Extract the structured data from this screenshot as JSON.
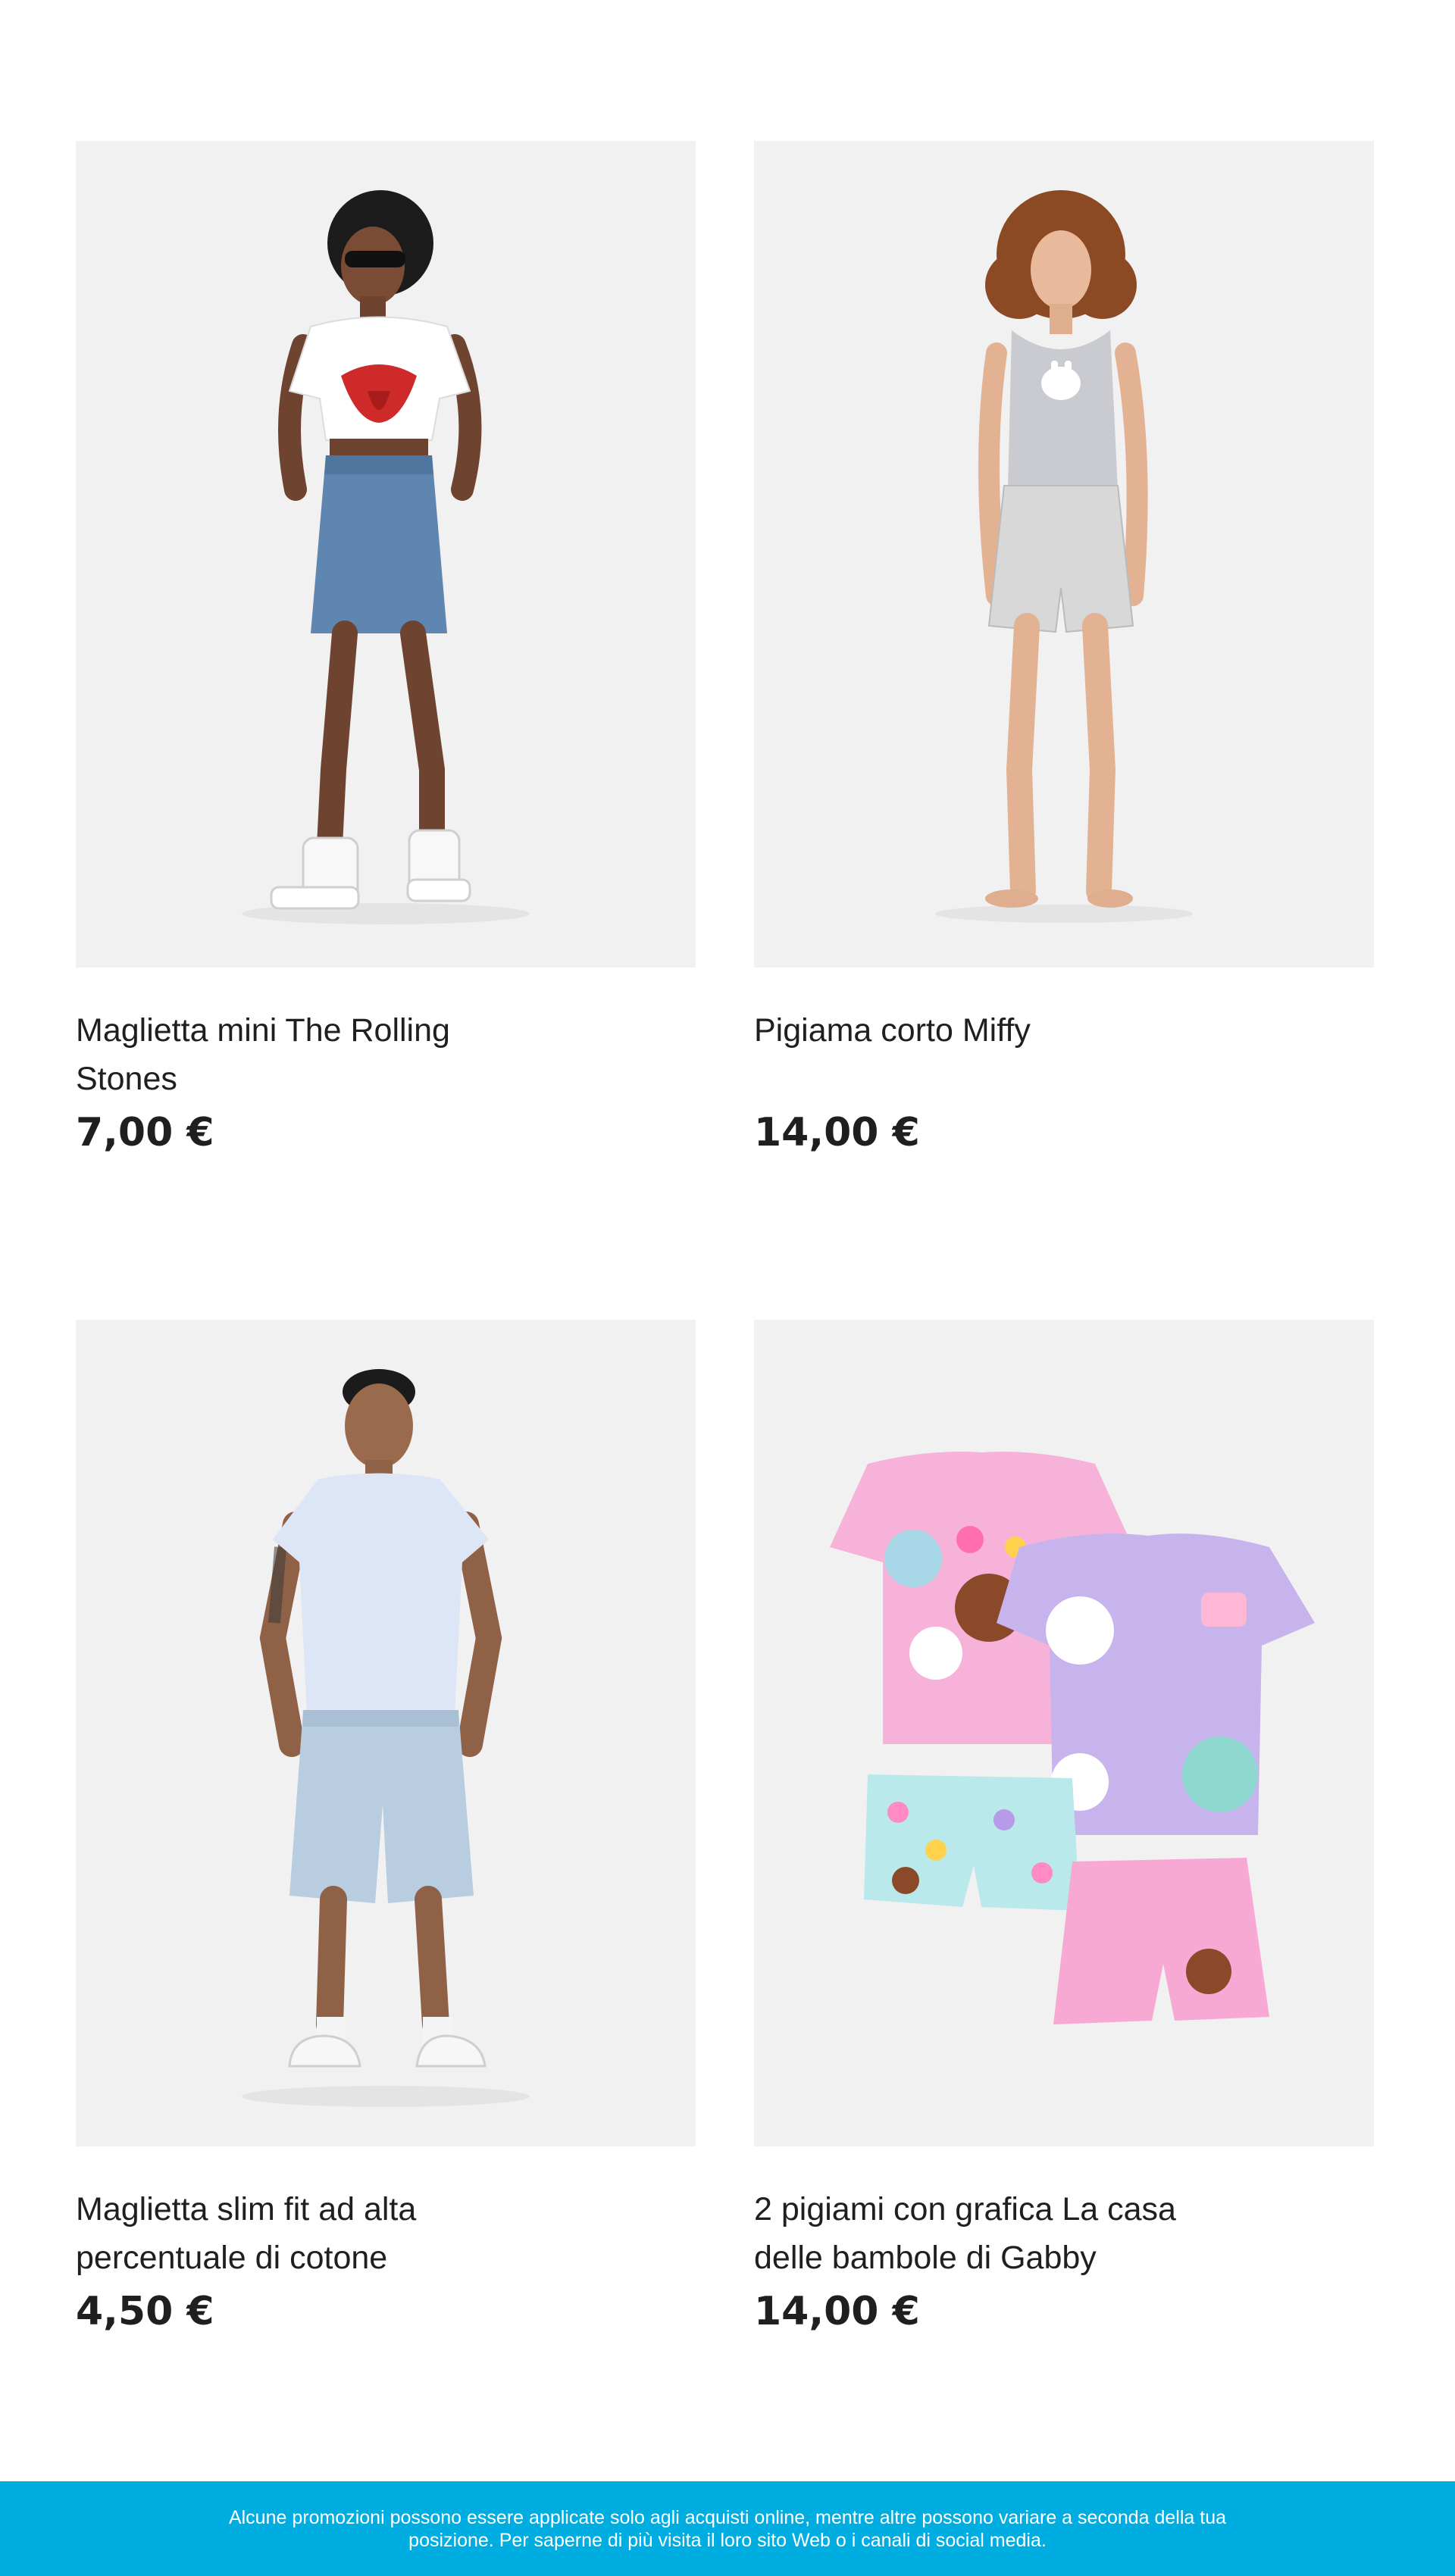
{
  "products": [
    {
      "title": "Maglietta mini The Rolling Stones",
      "price": "7,00 €",
      "image": "woman-rolling-stones-tee-denim-skirt"
    },
    {
      "title": "Pigiama corto Miffy",
      "price": "14,00 €",
      "image": "woman-grey-tank-gingham-shorts"
    },
    {
      "title": "Maglietta slim fit ad alta percentuale di cotone",
      "price": "4,50 €",
      "image": "man-light-blue-tee-denim-shorts"
    },
    {
      "title": "2 pigiami con grafica La casa delle bambole di Gabby",
      "price": "14,00 €",
      "image": "gabby-dollhouse-pajama-sets"
    }
  ],
  "footer": {
    "text": "Alcune promozioni possono essere applicate solo agli acquisti online, mentre altre possono variare a seconda della tua posizione. Per saperne di più visita il loro sito Web o i canali di social media."
  },
  "colors": {
    "banner": "#00ade0",
    "image_bg": "#f1f1f1",
    "text": "#1f1f1f"
  }
}
